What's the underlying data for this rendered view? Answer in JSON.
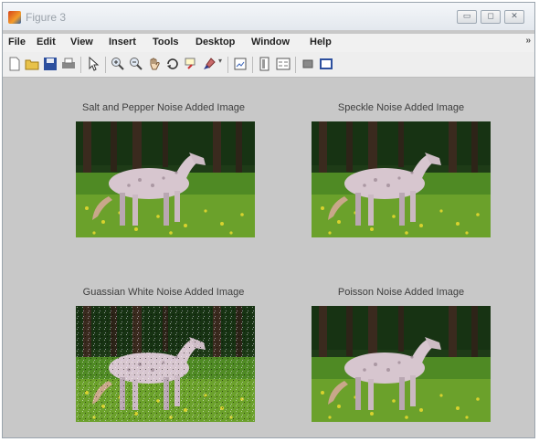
{
  "window": {
    "title": "Figure 3",
    "min_glyph": "▭",
    "max_glyph": "◻",
    "close_glyph": "✕"
  },
  "menu": {
    "items": [
      "File",
      "Edit",
      "View",
      "Insert",
      "Tools",
      "Desktop",
      "Window",
      "Help"
    ],
    "overflow_glyph": "»"
  },
  "toolbar": {
    "icons": [
      "new-figure-icon",
      "open-file-icon",
      "save-icon",
      "print-icon",
      "pointer-icon",
      "zoom-in-icon",
      "zoom-out-icon",
      "pan-icon",
      "rotate-3d-icon",
      "data-cursor-icon",
      "brush-icon",
      "link-plot-icon",
      "colorbar-icon",
      "legend-icon",
      "hide-plot-tools-icon",
      "show-plot-tools-icon"
    ]
  },
  "subplots": [
    {
      "title": "Salt and Pepper Noise Added Image"
    },
    {
      "title": "Speckle Noise Added Image"
    },
    {
      "title": "Guassian White Noise Added Image"
    },
    {
      "title": "Poisson Noise Added Image"
    }
  ],
  "colors": {
    "figure_bg": "#c8c8c8",
    "menubar_bg": "#f1f1f1",
    "toolbar_bg": "#eeeeee"
  }
}
